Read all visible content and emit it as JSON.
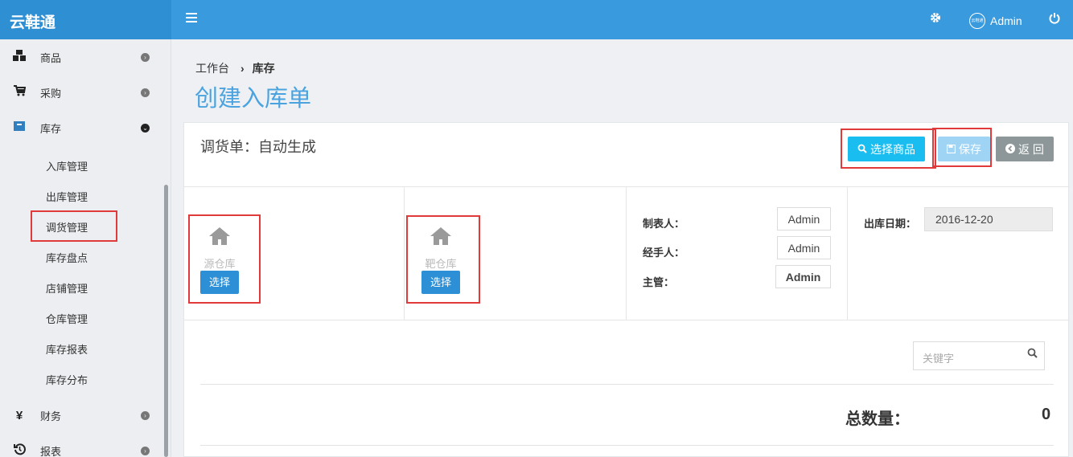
{
  "app": {
    "brand": "云鞋通"
  },
  "topbar": {
    "user": "Admin",
    "avatar_text": "云鞋通"
  },
  "sidebar": {
    "items": [
      {
        "label": "商品",
        "icon": "cubes-icon"
      },
      {
        "label": "采购",
        "icon": "cart-icon"
      },
      {
        "label": "库存",
        "icon": "archive-icon",
        "expanded": true
      },
      {
        "label": "财务",
        "icon": "yen-icon"
      },
      {
        "label": "报表",
        "icon": "history-icon"
      }
    ],
    "sub_items": [
      "入库管理",
      "出库管理",
      "调货管理",
      "库存盘点",
      "店铺管理",
      "仓库管理",
      "库存报表",
      "库存分布"
    ],
    "active_sub": "调货管理"
  },
  "breadcrumb": {
    "root": "工作台",
    "sep": "›",
    "current": "库存"
  },
  "page": {
    "title": "创建入库单"
  },
  "form": {
    "doc_no": "调货单：自动生成",
    "buttons": {
      "pick": "选择商品",
      "save": "保存",
      "back": "返 回"
    },
    "source_wh": {
      "label": "源仓库",
      "btn": "选择"
    },
    "target_wh": {
      "label": "靶仓库",
      "btn": "选择"
    },
    "maker_label": "制表人：",
    "maker_value": "Admin",
    "handler_label": "经手人：",
    "handler_value": "Admin",
    "supervisor_label": "主管：",
    "supervisor_value": "Admin",
    "date_label": "出库日期：",
    "date_value": "2016-12-20",
    "search_placeholder": "关键字",
    "total_label": "总数量：",
    "total_value": "0"
  },
  "colors": {
    "topbar": "#3a9ade",
    "brand_bar": "#2f8fd3",
    "title": "#4aa3df",
    "highlight": "#e03a3a"
  }
}
